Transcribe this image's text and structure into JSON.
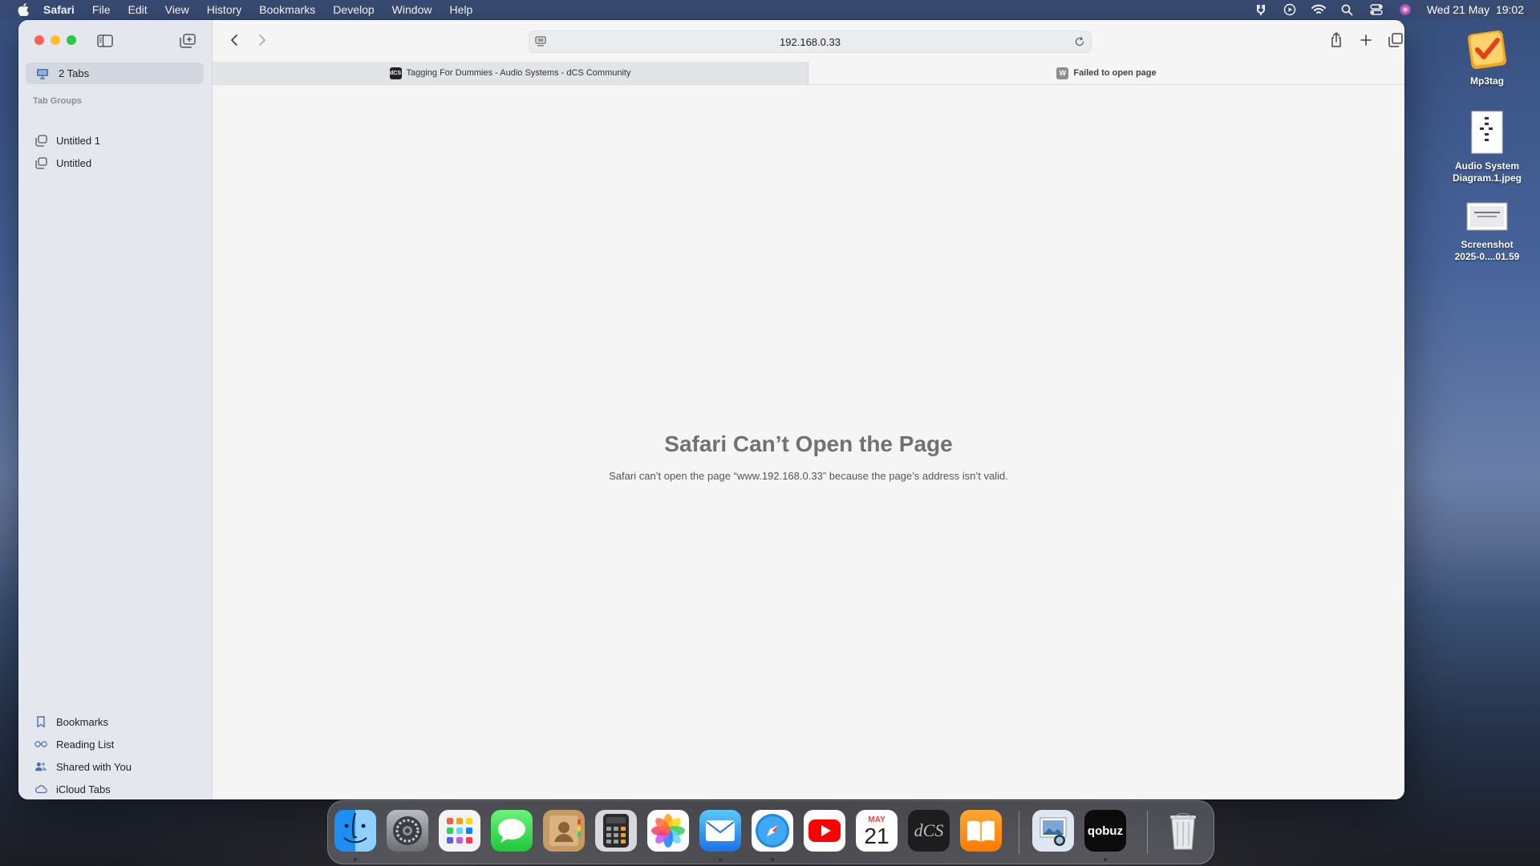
{
  "menubar": {
    "items": [
      "Safari",
      "File",
      "Edit",
      "View",
      "History",
      "Bookmarks",
      "Develop",
      "Window",
      "Help"
    ],
    "status_icons": [
      "lasso-icon",
      "play-circle-icon",
      "wifi-icon",
      "search-icon",
      "control-center-icon",
      "siri-icon"
    ],
    "datetime": "Wed 21 May  19:02"
  },
  "sidebar": {
    "tabs_label": "2 Tabs",
    "tab_groups_title": "Tab Groups",
    "tab_groups": [
      "Untitled 1",
      "Untitled"
    ],
    "bottom_items": [
      "Bookmarks",
      "Reading List",
      "Shared with You",
      "iCloud Tabs"
    ]
  },
  "toolbar": {
    "url": "192.168.0.33"
  },
  "tabs": [
    {
      "title": "Tagging For Dummies - Audio Systems - dCS Community",
      "favicon": "dCS"
    },
    {
      "title": "Failed to open page",
      "favicon": "W"
    }
  ],
  "error": {
    "title": "Safari Can’t Open the Page",
    "message": "Safari can’t open the page “www.192.168.0.33” because the page’s address isn’t valid."
  },
  "desktop": {
    "icons": [
      {
        "label": "Mp3tag"
      },
      {
        "label_line1": "Audio System",
        "label_line2": "Diagram.1.jpeg"
      },
      {
        "label_line1": "Screenshot",
        "label_line2": "2025-0....01.59"
      }
    ]
  },
  "dock": {
    "calendar_month": "MAY",
    "calendar_day": "21",
    "dcs_text": "dCS",
    "qobuz_text": "qobuz"
  },
  "colors": {
    "close": "#ff5f57",
    "minimize": "#febc2e",
    "zoom": "#28c840",
    "accent": "#1a73e8"
  }
}
